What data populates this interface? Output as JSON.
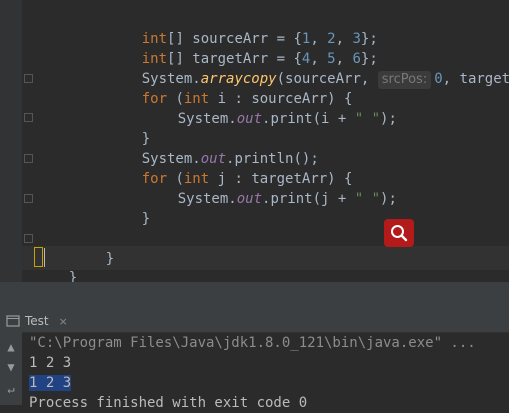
{
  "editor": {
    "lines": [
      {
        "text_a": "int",
        "text_b": "[] sourceArr = {",
        "n1": "1",
        "n2": "2",
        "n3": "3",
        "end": "};"
      },
      {
        "text_a": "int",
        "text_b": "[] targetArr = {",
        "n1": "4",
        "n2": "5",
        "n3": "6",
        "end": "};"
      },
      {
        "cls": "System.",
        "meth": "arraycopy",
        "open": "(sourceArr, ",
        "hint": "srcPos:",
        "zero": "0",
        "rest": ", targetA"
      },
      {
        "kw_for": "for",
        "paren": " (",
        "kw_int": "int",
        "rest": " i : sourceArr) {"
      },
      {
        "cls": "System.",
        "field": "out",
        "call": ".print(i + ",
        "str": "\" \"",
        "end": ");"
      },
      {
        "text": "}"
      },
      {
        "cls": "System.",
        "field": "out",
        "call": ".println();"
      },
      {
        "kw_for": "for",
        "paren": " (",
        "kw_int": "int",
        "rest": " j : targetArr) {"
      },
      {
        "cls": "System.",
        "field": "out",
        "call": ".print(j + ",
        "str": "\" \"",
        "end": ");"
      },
      {
        "text": "}"
      },
      {
        "text": "}"
      },
      {
        "text": "}"
      }
    ]
  },
  "run_panel": {
    "tab_label": "Test",
    "tab_close": "×",
    "console": {
      "command": "\"C:\\Program Files\\Java\\jdk1.8.0_121\\bin\\java.exe\" ...",
      "output1": "1 2 3",
      "output2": "1 2 3",
      "exit_message": "Process finished with exit code 0"
    }
  },
  "colors": {
    "keyword": "#cc7832",
    "number": "#6897bb",
    "string": "#6a8759",
    "field": "#9876aa",
    "method": "#ffc66d",
    "search_button": "#b31b1b"
  }
}
